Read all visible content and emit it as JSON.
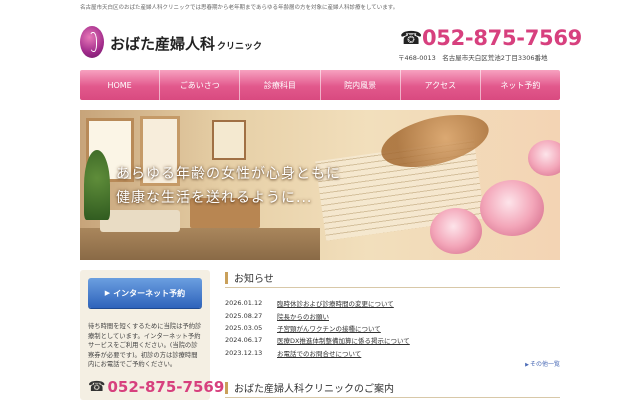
{
  "header": {
    "tagline": "名古屋市天白区のおばた産婦人科クリニックでは思春期から老年期まであらゆる年齢層の方を対象に産婦人科診療をしています。",
    "logo_name": "おばた産婦人科",
    "logo_sub": "クリニック",
    "phone": "052-875-7569",
    "address": "〒468-0013　名古屋市天白区荒池2丁目3306番地"
  },
  "nav": {
    "items": [
      "HOME",
      "ごあいさつ",
      "診療科目",
      "院内風景",
      "アクセス",
      "ネット予約"
    ]
  },
  "hero": {
    "line1": "あらゆる年齢の女性が心身ともに",
    "line2": "健康な生活を送れるように..."
  },
  "sidebar": {
    "button_label": "インターネット予約",
    "text": "待ち時間を短くするために当院は予約診療制としています。インターネット予約サービスをご利用ください。(当院の診察券が必要です)。初診の方は診療時間内にお電話でご予約ください。",
    "phone": "052-875-7569"
  },
  "news": {
    "heading": "お知らせ",
    "items": [
      {
        "date": "2026.01.12",
        "title": "臨時休診および診療時間の変更について"
      },
      {
        "date": "2025.08.27",
        "title": "院長からのお願い"
      },
      {
        "date": "2025.03.05",
        "title": "子宮頸がんワクチンの接種について"
      },
      {
        "date": "2024.06.17",
        "title": "医療DX推進体制整備加算に係る掲示について"
      },
      {
        "date": "2023.12.13",
        "title": "お電話でのお問合せについて"
      }
    ],
    "more_label": "その他一覧"
  },
  "guide": {
    "heading": "おばた産婦人科クリニックのご案内"
  },
  "colors": {
    "accent_pink": "#d7407e",
    "nav_pink": "#e2588c",
    "button_blue": "#2e63bb",
    "heading_bar": "#c9a05a"
  }
}
